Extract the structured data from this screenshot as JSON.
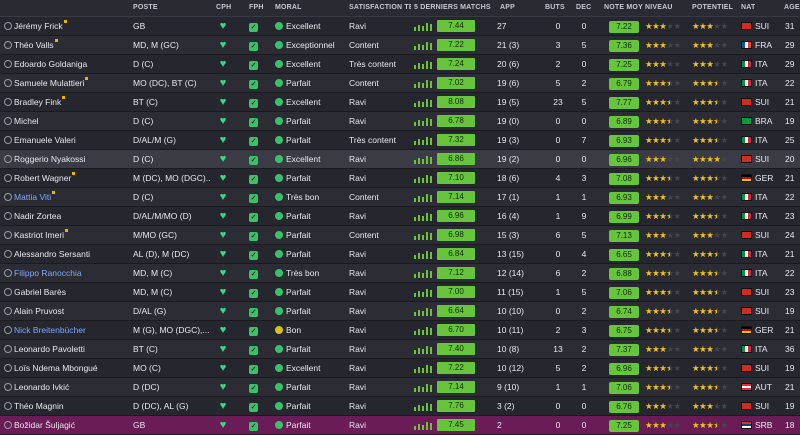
{
  "headers": {
    "poste": "POSTE",
    "cph": "CPH",
    "fph": "FPH",
    "moral": "MORAL",
    "satisfaction": "SATISFACTION TEM...",
    "form": "5 DERNIERS MATCHS",
    "app": "APP",
    "buts": "BUTS",
    "dec": "DÉC",
    "note": "NOTE MOY",
    "niveau": "NIVEAU",
    "potentiel": "POTENTIEL",
    "nat": "NAT",
    "age": "ÂGE"
  },
  "colors": {
    "rating_green": "#66c53a",
    "star_gold": "#f1c21b",
    "link_blue": "#7fa8ff",
    "selected_row": "#6a1c56"
  },
  "players": [
    {
      "name": "Jérémy Frick",
      "mark": true,
      "link": false,
      "pos": "GB",
      "moral": "Excellent",
      "mood": "g",
      "sat": "Ravi",
      "form": "7.44",
      "app": "27",
      "buts": "0",
      "dec": "0",
      "note": "7.22",
      "niv": 3,
      "pot": 3,
      "nat": "SUI",
      "flag": "sui",
      "age": "31"
    },
    {
      "name": "Théo Valls",
      "mark": true,
      "link": false,
      "pos": "MD, M (GC)",
      "moral": "Exceptionnel",
      "mood": "g",
      "sat": "Content",
      "form": "7.22",
      "app": "21 (3)",
      "buts": "3",
      "dec": "5",
      "note": "7.36",
      "niv": 3,
      "pot": 3,
      "nat": "FRA",
      "flag": "fra",
      "age": "29"
    },
    {
      "name": "Edoardo Goldaniga",
      "mark": false,
      "link": false,
      "pos": "D (C)",
      "moral": "Excellent",
      "mood": "g",
      "sat": "Très content",
      "form": "7.24",
      "app": "20 (6)",
      "buts": "2",
      "dec": "0",
      "note": "7.25",
      "niv": 3,
      "pot": 3,
      "nat": "ITA",
      "flag": "ita",
      "age": "29"
    },
    {
      "name": "Samuele Mulattieri",
      "mark": true,
      "link": false,
      "pos": "MO (DC), BT (C)",
      "moral": "Parfait",
      "mood": "g",
      "sat": "Content",
      "form": "7.02",
      "app": "19 (6)",
      "buts": "5",
      "dec": "2",
      "note": "6.79",
      "niv": 3.5,
      "pot": 3.5,
      "nat": "ITA",
      "flag": "ita",
      "age": "22"
    },
    {
      "name": "Bradley Fink",
      "mark": true,
      "link": false,
      "pos": "BT (C)",
      "moral": "Excellent",
      "mood": "g",
      "sat": "Ravi",
      "form": "8.08",
      "app": "19 (5)",
      "buts": "23",
      "dec": "5",
      "note": "7.77",
      "niv": 3.5,
      "pot": 3.5,
      "nat": "SUI",
      "flag": "sui",
      "age": "21"
    },
    {
      "name": "Michel",
      "mark": false,
      "link": false,
      "pos": "D (C)",
      "moral": "Parfait",
      "mood": "g",
      "sat": "Ravi",
      "form": "6.78",
      "app": "19 (0)",
      "buts": "0",
      "dec": "0",
      "note": "6.89",
      "niv": 3.5,
      "pot": 3.5,
      "nat": "BRA",
      "flag": "bra",
      "age": "19"
    },
    {
      "name": "Emanuele Valeri",
      "mark": false,
      "link": false,
      "pos": "D/AL/M (G)",
      "moral": "Parfait",
      "mood": "g",
      "sat": "Très content",
      "form": "7.32",
      "app": "19 (3)",
      "buts": "0",
      "dec": "7",
      "note": "6.93",
      "niv": 3.5,
      "pot": 3.5,
      "nat": "ITA",
      "flag": "ita",
      "age": "25"
    },
    {
      "name": "Roggerio Nyakossi",
      "mark": false,
      "link": false,
      "pos": "D (C)",
      "moral": "Excellent",
      "mood": "g",
      "sat": "Ravi",
      "form": "6.86",
      "app": "19 (2)",
      "buts": "0",
      "dec": "0",
      "note": "6.96",
      "niv": 3,
      "pot": 4,
      "nat": "SUI",
      "flag": "sui",
      "age": "20"
    },
    {
      "name": "Robert Wagner",
      "mark": true,
      "link": false,
      "pos": "M (DC), MO (DGC)...",
      "moral": "Parfait",
      "mood": "g",
      "sat": "Ravi",
      "form": "7.10",
      "app": "18 (6)",
      "buts": "4",
      "dec": "3",
      "note": "7.08",
      "niv": 3.5,
      "pot": 3.5,
      "nat": "GER",
      "flag": "ger",
      "age": "21"
    },
    {
      "name": "Mattia Viti",
      "mark": true,
      "link": true,
      "pos": "D (C)",
      "moral": "Très bon",
      "mood": "g",
      "sat": "Content",
      "form": "7.14",
      "app": "17 (1)",
      "buts": "1",
      "dec": "1",
      "note": "6.93",
      "niv": 3,
      "pot": 3,
      "nat": "ITA",
      "flag": "ita",
      "age": "22"
    },
    {
      "name": "Nadir Zortea",
      "mark": false,
      "link": false,
      "pos": "D/AL/M/MO (D)",
      "moral": "Parfait",
      "mood": "g",
      "sat": "Ravi",
      "form": "6.96",
      "app": "16 (4)",
      "buts": "1",
      "dec": "9",
      "note": "6.99",
      "niv": 3.5,
      "pot": 3.5,
      "nat": "ITA",
      "flag": "ita",
      "age": "23"
    },
    {
      "name": "Kastriot Imeri",
      "mark": true,
      "link": false,
      "pos": "M/MO (GC)",
      "moral": "Parfait",
      "mood": "g",
      "sat": "Content",
      "form": "6.98",
      "app": "15 (3)",
      "buts": "6",
      "dec": "5",
      "note": "7.13",
      "niv": 3,
      "pot": 3,
      "nat": "SUI",
      "flag": "sui",
      "age": "24"
    },
    {
      "name": "Alessandro Sersanti",
      "mark": false,
      "link": false,
      "pos": "AL (D), M (DC)",
      "moral": "Parfait",
      "mood": "g",
      "sat": "Ravi",
      "form": "6.84",
      "app": "13 (15)",
      "buts": "0",
      "dec": "4",
      "note": "6.65",
      "niv": 3.5,
      "pot": 3.5,
      "nat": "ITA",
      "flag": "ita",
      "age": "21"
    },
    {
      "name": "Filippo Ranocchia",
      "mark": false,
      "link": true,
      "pos": "MD, M (C)",
      "moral": "Très bon",
      "mood": "g",
      "sat": "Ravi",
      "form": "7.12",
      "app": "12 (14)",
      "buts": "6",
      "dec": "2",
      "note": "6.88",
      "niv": 3.5,
      "pot": 3.5,
      "nat": "ITA",
      "flag": "ita",
      "age": "22"
    },
    {
      "name": "Gabriel Barès",
      "mark": false,
      "link": false,
      "pos": "MD, M (C)",
      "moral": "Parfait",
      "mood": "g",
      "sat": "Ravi",
      "form": "7.00",
      "app": "11 (15)",
      "buts": "1",
      "dec": "5",
      "note": "7.06",
      "niv": 3.5,
      "pot": 3.5,
      "nat": "SUI",
      "flag": "sui",
      "age": "23"
    },
    {
      "name": "Alain Pruvost",
      "mark": false,
      "link": false,
      "pos": "D/AL (G)",
      "moral": "Parfait",
      "mood": "g",
      "sat": "Ravi",
      "form": "6.64",
      "app": "10 (10)",
      "buts": "0",
      "dec": "2",
      "note": "6.74",
      "niv": 3.5,
      "pot": 3.5,
      "nat": "SUI",
      "flag": "sui",
      "age": "19"
    },
    {
      "name": "Nick Breitenbücher",
      "mark": false,
      "link": true,
      "pos": "M (G), MO (DGC),...",
      "moral": "Bon",
      "mood": "y",
      "sat": "Ravi",
      "form": "6.70",
      "app": "10 (11)",
      "buts": "2",
      "dec": "3",
      "note": "6.75",
      "niv": 3.5,
      "pot": 3.5,
      "nat": "GER",
      "flag": "ger",
      "age": "21"
    },
    {
      "name": "Leonardo Pavoletti",
      "mark": false,
      "link": false,
      "pos": "BT (C)",
      "moral": "Parfait",
      "mood": "g",
      "sat": "Ravi",
      "form": "7.40",
      "app": "10 (8)",
      "buts": "13",
      "dec": "2",
      "note": "7.37",
      "niv": 3,
      "pot": 3,
      "nat": "ITA",
      "flag": "ita",
      "age": "36"
    },
    {
      "name": "Loïs Ndema Mbongué",
      "mark": false,
      "link": false,
      "pos": "MO (C)",
      "moral": "Excellent",
      "mood": "g",
      "sat": "Ravi",
      "form": "7.22",
      "app": "10 (12)",
      "buts": "5",
      "dec": "2",
      "note": "6.96",
      "niv": 3.5,
      "pot": 3.5,
      "nat": "SUI",
      "flag": "sui",
      "age": "19"
    },
    {
      "name": "Leonardo Ivkić",
      "mark": false,
      "link": false,
      "pos": "D (DC)",
      "moral": "Parfait",
      "mood": "g",
      "sat": "Ravi",
      "form": "7.14",
      "app": "9 (10)",
      "buts": "1",
      "dec": "1",
      "note": "7.06",
      "niv": 3.5,
      "pot": 3.5,
      "nat": "AUT",
      "flag": "aut",
      "age": "21"
    },
    {
      "name": "Théo Magnin",
      "mark": false,
      "link": false,
      "pos": "D (DC), AL (G)",
      "moral": "Parfait",
      "mood": "g",
      "sat": "Ravi",
      "form": "7.76",
      "app": "3 (2)",
      "buts": "0",
      "dec": "0",
      "note": "6.76",
      "niv": 3,
      "pot": 3,
      "nat": "SUI",
      "flag": "sui",
      "age": "19"
    },
    {
      "name": "Božidar Šuljagić",
      "mark": false,
      "link": false,
      "pos": "GB",
      "moral": "Parfait",
      "mood": "g",
      "sat": "Ravi",
      "form": "7.45",
      "app": "2",
      "buts": "0",
      "dec": "0",
      "note": "7.25",
      "niv": 3,
      "pot": 3.5,
      "nat": "SRB",
      "flag": "srb",
      "age": "18"
    }
  ]
}
